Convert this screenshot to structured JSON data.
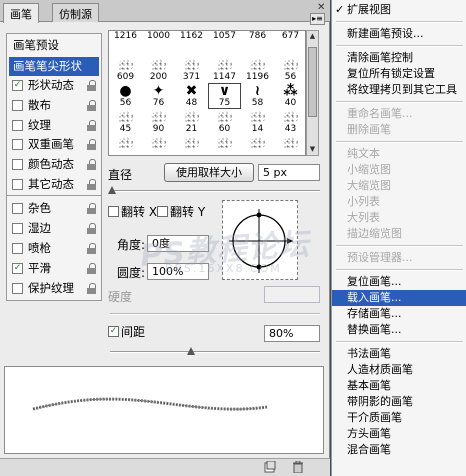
{
  "tabs": [
    {
      "label": "画笔"
    },
    {
      "label": "仿制源"
    }
  ],
  "options": [
    {
      "label": "画笔预设",
      "kind": "header"
    },
    {
      "label": "画笔笔尖形状",
      "kind": "selected"
    },
    {
      "label": "形状动态",
      "checked": true
    },
    {
      "label": "散布",
      "checked": false
    },
    {
      "label": "纹理",
      "checked": false
    },
    {
      "label": "双重画笔",
      "checked": false
    },
    {
      "label": "颜色动态",
      "checked": false
    },
    {
      "label": "其它动态",
      "checked": false
    },
    {
      "label": "杂色",
      "checked": false
    },
    {
      "label": "湿边",
      "checked": false
    },
    {
      "label": "喷枪",
      "checked": false
    },
    {
      "label": "平滑",
      "checked": true
    },
    {
      "label": "保护纹理",
      "checked": false
    }
  ],
  "brush_tips": {
    "row1_numbers": [
      "1216",
      "1000",
      "1162",
      "1057",
      "786",
      "677"
    ],
    "row2_numbers": [
      "609",
      "200",
      "371",
      "1147",
      "1196",
      "56"
    ],
    "row3_numbers": [
      "56",
      "76",
      "48",
      "75",
      "58",
      "40"
    ],
    "row4_numbers": [
      "45",
      "90",
      "21",
      "60",
      "14",
      "43"
    ],
    "selected_index": 3
  },
  "controls": {
    "diameter_label": "直径",
    "use_sample_size_label": "使用取样大小",
    "diameter_value": "5 px",
    "flip_x_label": "翻转 X",
    "flip_y_label": "翻转 Y",
    "angle_label": "角度:",
    "angle_value": "0度",
    "roundness_label": "圆度:",
    "roundness_value": "100%",
    "hardness_label": "硬度",
    "spacing_label": "间距",
    "spacing_value": "80%",
    "spacing_checked": true
  },
  "watermark": {
    "line1": "PS教程论坛",
    "line2": "BBS.16XX8.COM"
  },
  "menu": {
    "items": [
      {
        "label": "扩展视图",
        "checked": true
      },
      {
        "sep": true
      },
      {
        "label": "新建画笔预设..."
      },
      {
        "sep": true
      },
      {
        "label": "清除画笔控制"
      },
      {
        "label": "复位所有锁定设置"
      },
      {
        "label": "将纹理拷贝到其它工具"
      },
      {
        "sep": true
      },
      {
        "label": "重命名画笔...",
        "disabled": true
      },
      {
        "label": "删除画笔",
        "disabled": true
      },
      {
        "sep": true
      },
      {
        "label": "纯文本",
        "disabled": true
      },
      {
        "label": "小缩览图",
        "disabled": true
      },
      {
        "label": "大缩览图",
        "disabled": true
      },
      {
        "label": "小列表",
        "disabled": true
      },
      {
        "label": "大列表",
        "disabled": true
      },
      {
        "label": "描边缩览图",
        "disabled": true
      },
      {
        "sep": true
      },
      {
        "label": "预设管理器...",
        "disabled": true
      },
      {
        "sep": true
      },
      {
        "label": "复位画笔..."
      },
      {
        "label": "载入画笔...",
        "highlighted": true
      },
      {
        "label": "存储画笔..."
      },
      {
        "label": "替换画笔..."
      },
      {
        "sep": true
      },
      {
        "label": "书法画笔"
      },
      {
        "label": "人造材质画笔"
      },
      {
        "label": "基本画笔"
      },
      {
        "label": "带阴影的画笔"
      },
      {
        "label": "干介质画笔"
      },
      {
        "label": "方头画笔"
      },
      {
        "label": "混合画笔"
      }
    ]
  }
}
